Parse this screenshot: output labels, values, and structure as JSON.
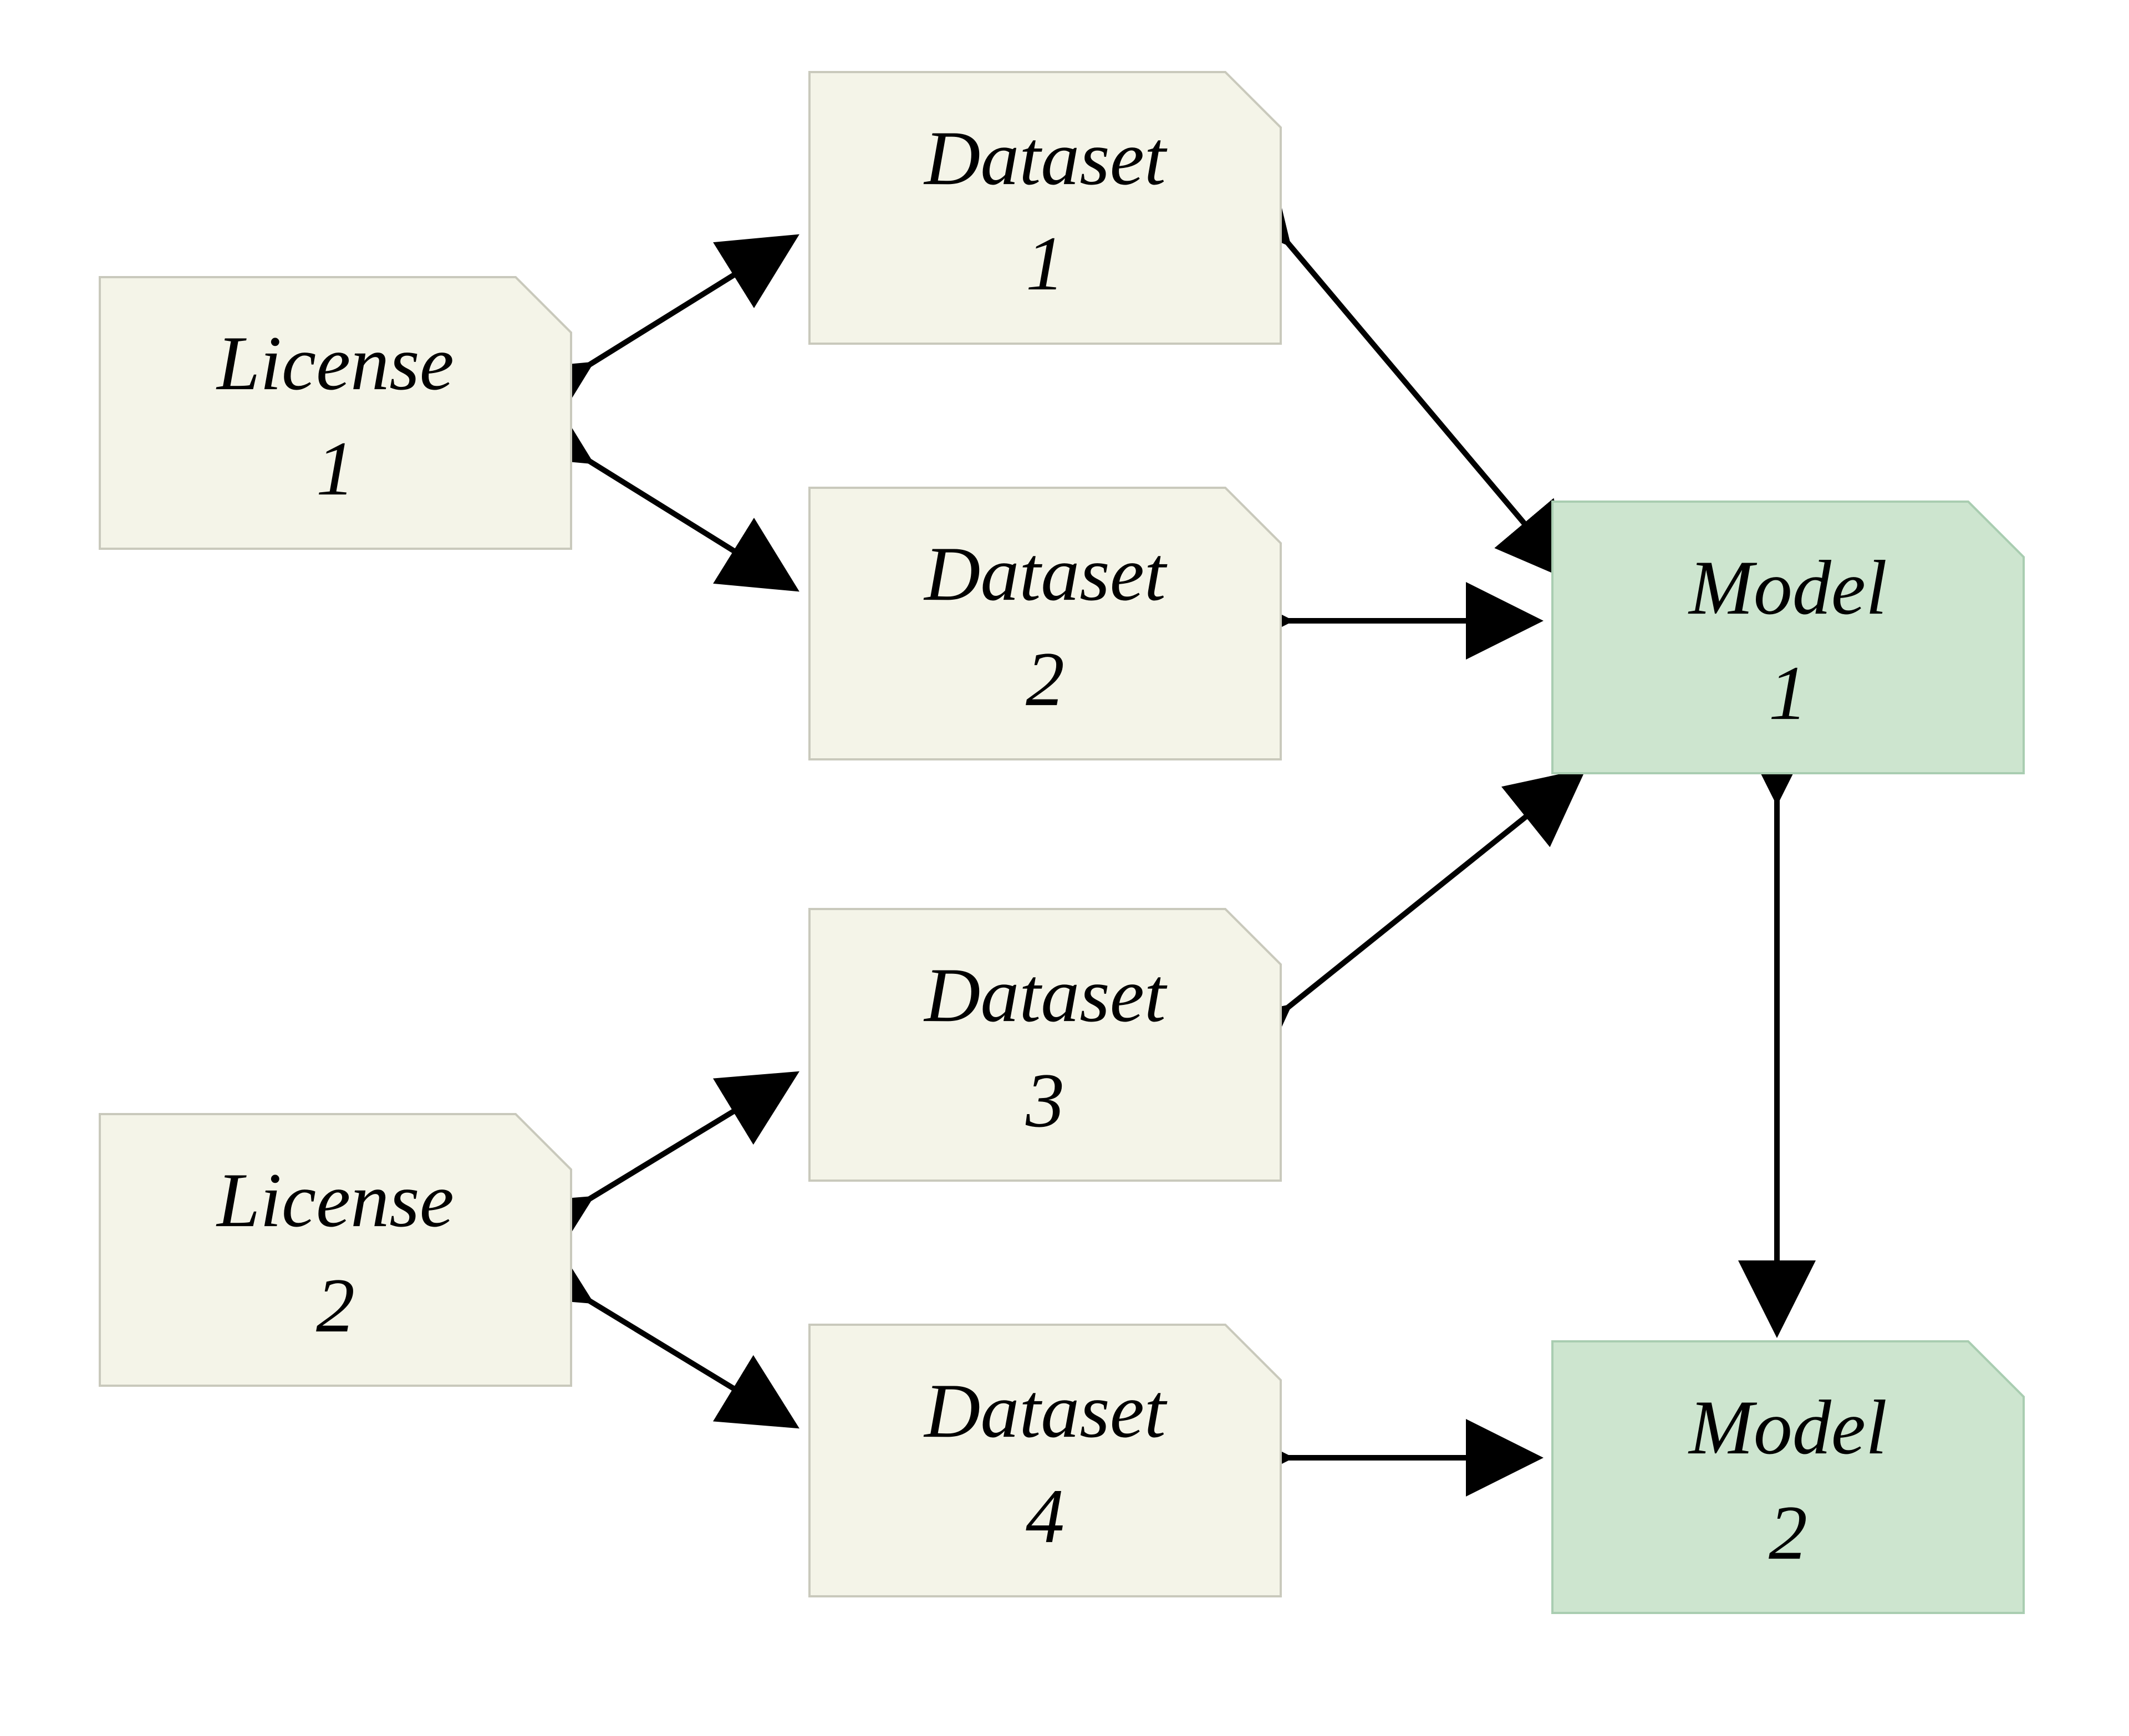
{
  "diagram": {
    "nodes": {
      "license1": {
        "line1": "License",
        "line2": "1",
        "fill": "#f4f4e8",
        "stroke": "#c9c9bc"
      },
      "license2": {
        "line1": "License",
        "line2": "2",
        "fill": "#f4f4e8",
        "stroke": "#c9c9bc"
      },
      "dataset1": {
        "line1": "Dataset",
        "line2": "1",
        "fill": "#f4f4e8",
        "stroke": "#c9c9bc"
      },
      "dataset2": {
        "line1": "Dataset",
        "line2": "2",
        "fill": "#f4f4e8",
        "stroke": "#c9c9bc"
      },
      "dataset3": {
        "line1": "Dataset",
        "line2": "3",
        "fill": "#f4f4e8",
        "stroke": "#c9c9bc"
      },
      "dataset4": {
        "line1": "Dataset",
        "line2": "4",
        "fill": "#f4f4e8",
        "stroke": "#c9c9bc"
      },
      "model1": {
        "line1": "Model",
        "line2": "1",
        "fill": "#cde5cf",
        "stroke": "#a9cdb1"
      },
      "model2": {
        "line1": "Model",
        "line2": "2",
        "fill": "#cde5cf",
        "stroke": "#a9cdb1"
      }
    },
    "edges": [
      {
        "from": "license1",
        "to": "dataset1",
        "bidirectional": true
      },
      {
        "from": "license1",
        "to": "dataset2",
        "bidirectional": true
      },
      {
        "from": "license2",
        "to": "dataset3",
        "bidirectional": true
      },
      {
        "from": "license2",
        "to": "dataset4",
        "bidirectional": true
      },
      {
        "from": "dataset1",
        "to": "model1",
        "bidirectional": true
      },
      {
        "from": "dataset2",
        "to": "model1",
        "bidirectional": true
      },
      {
        "from": "dataset3",
        "to": "model1",
        "bidirectional": true
      },
      {
        "from": "dataset4",
        "to": "model2",
        "bidirectional": true
      },
      {
        "from": "model1",
        "to": "model2",
        "bidirectional": true
      }
    ]
  }
}
